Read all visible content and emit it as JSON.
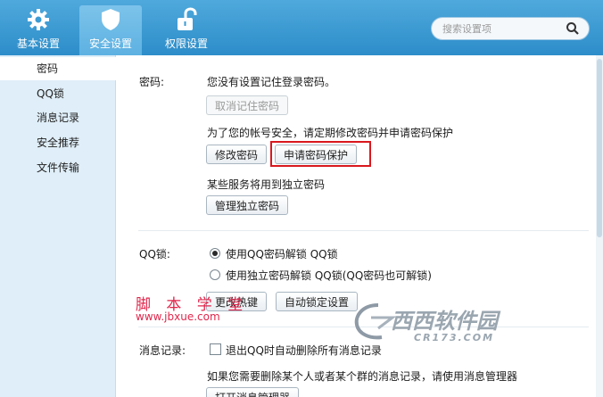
{
  "tabs": [
    {
      "label": "基本设置",
      "icon": "gear-icon"
    },
    {
      "label": "安全设置",
      "icon": "shield-icon"
    },
    {
      "label": "权限设置",
      "icon": "unlock-icon"
    }
  ],
  "search": {
    "placeholder": "搜索设置项"
  },
  "sidebar": {
    "items": [
      {
        "label": "密码"
      },
      {
        "label": "QQ锁"
      },
      {
        "label": "消息记录"
      },
      {
        "label": "安全推荐"
      },
      {
        "label": "文件传输"
      }
    ]
  },
  "password": {
    "section_label": "密码:",
    "status_text": "您没有设置记住登录密码。",
    "cancel_remember_label": "取消记住密码",
    "advice_text": "为了您的帐号安全，请定期修改密码并申请密码保护",
    "change_label": "修改密码",
    "apply_protect_label": "申请密码保护",
    "services_text": "某些服务将用到独立密码",
    "manage_independent_label": "管理独立密码"
  },
  "qqlock": {
    "section_label": "QQ锁:",
    "option1": "使用QQ密码解锁 QQ锁",
    "option2": "使用独立密码解锁 QQ锁(QQ密码也可解锁)",
    "hotkey_label": "更改热键",
    "autolock_label": "自动锁定设置"
  },
  "messages": {
    "section_label": "消息记录:",
    "auto_delete_label": "退出QQ时自动删除所有消息记录",
    "hint_text": "如果您需要删除某个人或者某个群的消息记录，请使用消息管理器",
    "open_manager_label": "打开消息管理器"
  },
  "watermark": {
    "cn_text": "脚 本 学 堂",
    "url_text": "www.jbxue.com",
    "brand_text": "西西软件园",
    "brand_sub": "CR173.COM"
  },
  "colors": {
    "accent": "#2d8dc9",
    "highlight_box": "#d9181e",
    "watermark": "#e0264b"
  }
}
